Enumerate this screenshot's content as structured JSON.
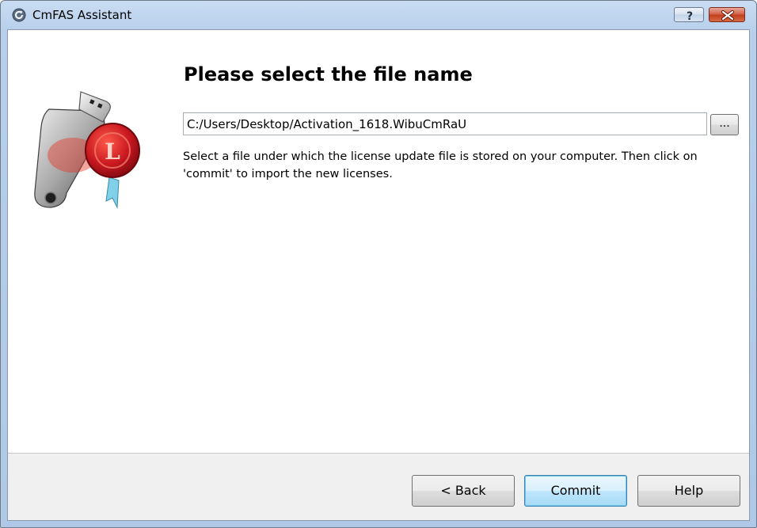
{
  "window": {
    "title": "CmFAS Assistant",
    "help_caption": "?",
    "close_caption": "x"
  },
  "page": {
    "heading": "Please select the file name",
    "file_path": "C:/Users/Desktop/Activation_1618.WibuCmRaU",
    "browse_label": "...",
    "description": "Select a file under which the license update file is stored on your computer. Then click on 'commit' to import the new licenses."
  },
  "footer": {
    "back_label": "< Back",
    "commit_label": "Commit",
    "help_label": "Help"
  },
  "icons": {
    "app": "refresh-icon",
    "wizard_image": "usb-license-key-with-wax-seal",
    "seal_letter": "L"
  },
  "colors": {
    "titlebar": "#b7cfeb",
    "close_button": "#c0401f",
    "default_button_border": "#3c7fb1",
    "seal": "#c8171f"
  }
}
